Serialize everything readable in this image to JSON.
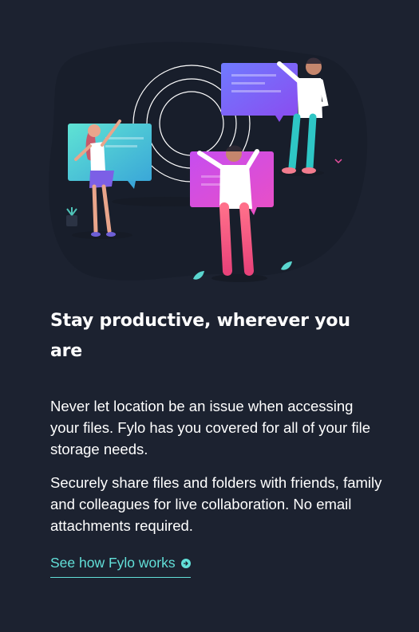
{
  "section": {
    "title": "Stay productive, wherever you are",
    "paragraphs": [
      "Never let location be an issue when accessing your files. Fylo has you covered for all of your file storage needs.",
      "Securely share files and folders with friends, family and colleagues for live collaboration. No email attachments required."
    ],
    "cta_label": "See how Fylo works",
    "cta_icon": "arrow-right-circle-icon"
  },
  "colors": {
    "background": "#1c2230",
    "accent": "#62e0d9",
    "text": "#ffffff"
  }
}
